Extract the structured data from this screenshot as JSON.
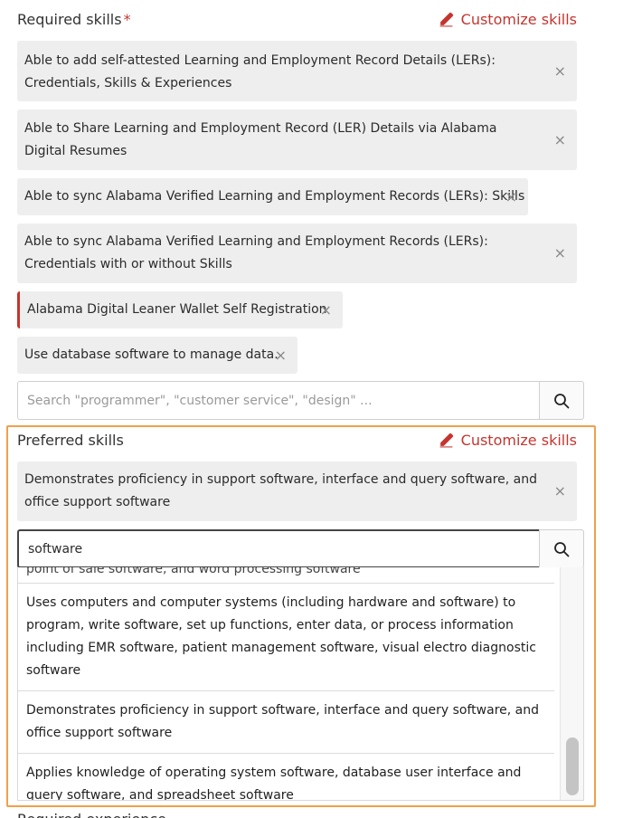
{
  "required": {
    "title": "Required skills",
    "required_mark": "*",
    "customize_label": "Customize skills",
    "chips": [
      {
        "text": "Able to add self-attested Learning and Employment Record Details (LERs): Credentials, Skills & Experiences"
      },
      {
        "text": "Able to Share Learning and Employment Record (LER) Details via Alabama Digital Resumes"
      },
      {
        "text": "Able to sync Alabama Verified Learning and Employment Records (LERs): Skills"
      },
      {
        "text": "Able to sync Alabama Verified Learning and Employment Records (LERs): Credentials with or without Skills"
      },
      {
        "text": "Alabama Digital Leaner Wallet Self Registration"
      },
      {
        "text": "Use database software to manage data."
      }
    ],
    "remove_glyph": "×",
    "search_placeholder": "Search \"programmer\", \"customer service\", \"design\" ..."
  },
  "preferred": {
    "title": "Preferred skills",
    "customize_label": "Customize skills",
    "chips": [
      {
        "text": "Demonstrates proficiency in support software, interface and query software, and office support software"
      }
    ],
    "search_value": "software",
    "results": [
      "point of sale software, and word processing software",
      "Uses computers and computer systems (including hardware and software) to program, write software, set up functions, enter data, or process information including EMR software, patient management software, visual electro diagnostic software",
      "Demonstrates proficiency in support software, interface and query software, and office support software",
      "Applies knowledge of operating system software, database user interface and query software, and spreadsheet software"
    ]
  },
  "next_section_title": "Required experience",
  "icons": {
    "edit": "pencil-icon",
    "search": "search-icon",
    "remove": "close-icon"
  },
  "colors": {
    "accent_red": "#c5352f",
    "focus_orange": "#f0a04b",
    "chip_bg": "#eeeeee"
  }
}
